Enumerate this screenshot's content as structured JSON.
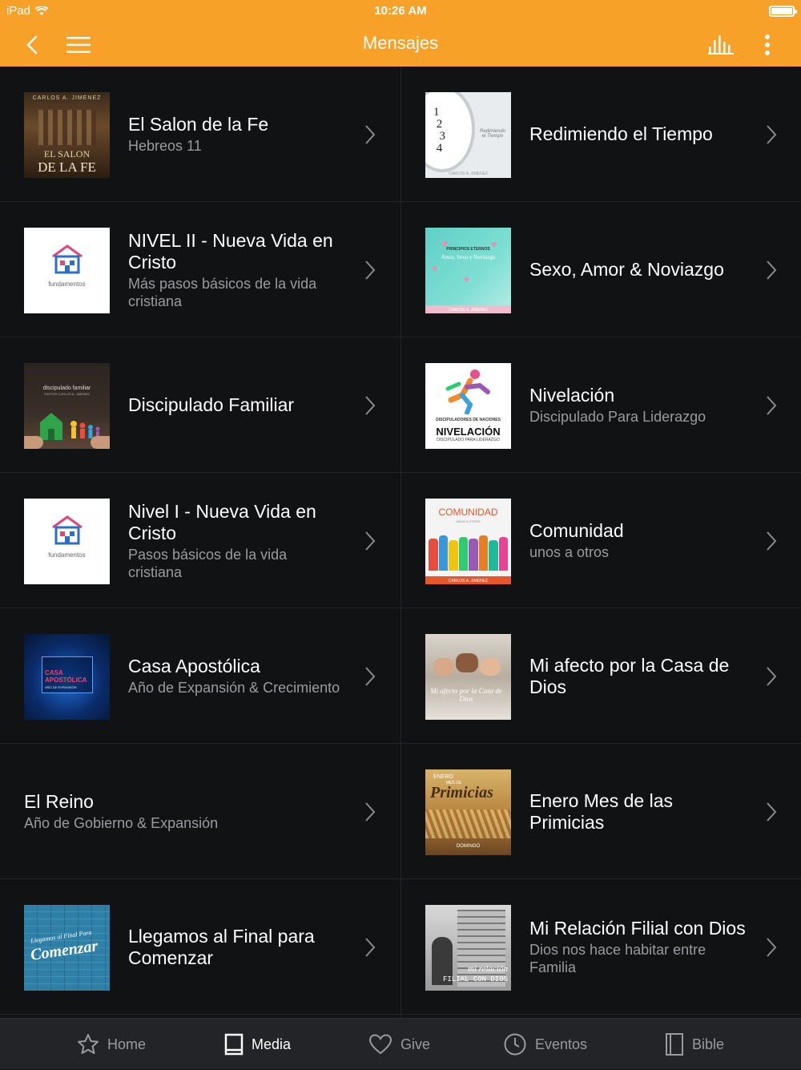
{
  "status": {
    "device": "iPad",
    "time": "10:26 AM"
  },
  "nav": {
    "title": "Mensajes"
  },
  "colors": {
    "accent": "#f7a129",
    "background": "#111214",
    "divider": "#23252a",
    "subtitle": "#9a9b9e"
  },
  "items": [
    {
      "title": "El Salon de la Fe",
      "subtitle": "Hebreos 11",
      "thumb": "el-salon-de-la-fe",
      "thumb_text": [
        "CARLOS A. JIMENEZ",
        "EL SALON",
        "DE LA FE"
      ]
    },
    {
      "title": "Redimiendo el Tiempo",
      "subtitle": "",
      "thumb": "redimiendo-el-tiempo",
      "thumb_text": [
        "Redimiendo el Tiempo",
        "CARLOS A. JIMENEZ"
      ]
    },
    {
      "title": "NIVEL II - Nueva Vida en Cristo",
      "subtitle": "Más pasos básicos de la vida cristiana",
      "thumb": "fundamentos",
      "thumb_text": [
        "fundamentos"
      ]
    },
    {
      "title": "Sexo, Amor & Noviazgo",
      "subtitle": "",
      "thumb": "sexo-amor-noviazgo",
      "thumb_text": [
        "PRINCIPIOS ETERNOS",
        "Amor, Sexo y Noviazgo",
        "CARLOS A. JIMENEZ"
      ]
    },
    {
      "title": "Discipulado Familiar",
      "subtitle": "",
      "thumb": "discipulado-familiar",
      "thumb_text": [
        "discipulado familiar",
        "PASTOR CARLOS A. JIMENEZ"
      ]
    },
    {
      "title": "Nivelación",
      "subtitle": "Discipulado Para Liderazgo",
      "thumb": "nivelacion",
      "thumb_text": [
        "DISCIPULADORES DE NACIONES",
        "NIVELACIÓN",
        "DISCIPULADO PARA LIDERAZGO"
      ]
    },
    {
      "title": "Nivel I - Nueva Vida en Cristo",
      "subtitle": "Pasos básicos de la vida cristiana",
      "thumb": "fundamentos",
      "thumb_text": [
        "fundamentos"
      ]
    },
    {
      "title": "Comunidad",
      "subtitle": "unos a otros",
      "thumb": "comunidad",
      "thumb_text": [
        "COMUNIDAD",
        "UNOS A OTROS",
        "CARLOS A. JIMENEZ"
      ]
    },
    {
      "title": "Casa Apostólica",
      "subtitle": "Año de Expansión & Crecimiento",
      "thumb": "casa-apostolica",
      "thumb_text": [
        "CASA APOSTÓLICA",
        "AÑO DE EXPANSIÓN"
      ]
    },
    {
      "title": "Mi afecto por la Casa de Dios",
      "subtitle": "",
      "thumb": "mi-afecto",
      "thumb_text": [
        "Mi afecto por la Casa de Dios"
      ]
    },
    {
      "title": "El Reino",
      "subtitle": "Año de Gobierno & Expansión",
      "thumb": "",
      "thumb_text": []
    },
    {
      "title": "Enero Mes de las Primicias",
      "subtitle": "",
      "thumb": "primicias",
      "thumb_text": [
        "ENERO",
        "MES DE",
        "Primicias",
        "DOMINGO"
      ]
    },
    {
      "title": "Llegamos al Final para Comenzar",
      "subtitle": "",
      "thumb": "llegamos",
      "thumb_text": [
        "Llegamos al Final Para",
        "Comenzar"
      ]
    },
    {
      "title": "Mi Relación Filial con Dios",
      "subtitle": "Dios nos hace habitar entre Familia",
      "thumb": "relacion-filial",
      "thumb_text": [
        "mi relación",
        "FILIAL CON DIOS"
      ]
    }
  ],
  "tabs": [
    {
      "label": "Home",
      "icon": "star-icon",
      "active": false
    },
    {
      "label": "Media",
      "icon": "book-icon",
      "active": true
    },
    {
      "label": "Give",
      "icon": "heart-icon",
      "active": false
    },
    {
      "label": "Eventos",
      "icon": "clock-icon",
      "active": false
    },
    {
      "label": "Bible",
      "icon": "bible-icon",
      "active": false
    }
  ]
}
